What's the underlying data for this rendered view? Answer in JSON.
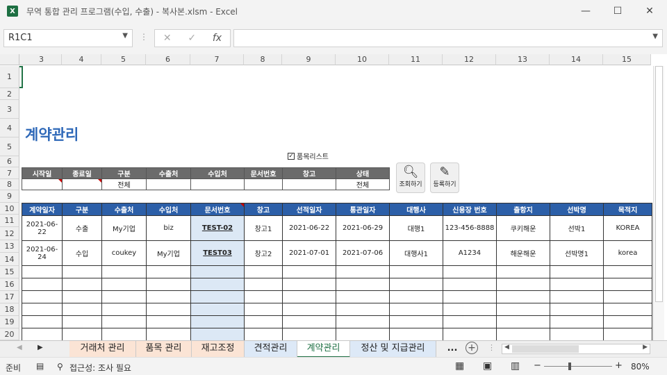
{
  "window": {
    "title": "무역 통합 관리 프로그램(수입, 수출) - 복사본.xlsm - Excel",
    "logo": "X"
  },
  "formula": {
    "namebox": "R1C1",
    "value": ""
  },
  "columns": [
    "3",
    "4",
    "5",
    "6",
    "7",
    "8",
    "9",
    "10",
    "11",
    "12",
    "13",
    "14",
    "15"
  ],
  "rows": [
    "1",
    "2",
    "3",
    "4",
    "5",
    "6",
    "7",
    "8",
    "9",
    "10",
    "11",
    "12",
    "13",
    "14",
    "15",
    "16",
    "17",
    "18",
    "19",
    "20"
  ],
  "heading": "계약관리",
  "checkbox": {
    "label": "품목리스트",
    "checked": true
  },
  "filter": {
    "headers": [
      "시작일",
      "종료일",
      "구분",
      "수출처",
      "수입처",
      "문서번호",
      "창고",
      "상태"
    ],
    "values": [
      "",
      "",
      "전체",
      "",
      "",
      "",
      "",
      "전체"
    ]
  },
  "buttons": {
    "search": "조회하기",
    "register": "등록하기"
  },
  "table": {
    "headers": [
      "계약일자",
      "구분",
      "수출처",
      "수입처",
      "문서번호",
      "창고",
      "선적일자",
      "통관일자",
      "대행사",
      "신용장 번호",
      "출항지",
      "선박명",
      "목적지"
    ],
    "rows": [
      [
        "2021-06-22",
        "수출",
        "My기업",
        "biz",
        "TEST-02",
        "창고1",
        "2021-06-22",
        "2021-06-29",
        "대행1",
        "123-456-8888",
        "쿠키해운",
        "선박1",
        "KOREA"
      ],
      [
        "2021-06-24",
        "수입",
        "coukey",
        "My기업",
        "TEST03",
        "창고2",
        "2021-07-01",
        "2021-07-06",
        "대행사1",
        "A1234",
        "해운해운",
        "선박명1",
        "korea"
      ]
    ]
  },
  "tabs": [
    "거래처 관리",
    "품목 관리",
    "재고조정",
    "견적관리",
    "계약관리",
    "정산 및 지급관리",
    "..."
  ],
  "active_tab": "계약관리",
  "status": {
    "ready": "준비",
    "accessibility": "접근성: 조사 필요",
    "zoom": "80%"
  }
}
